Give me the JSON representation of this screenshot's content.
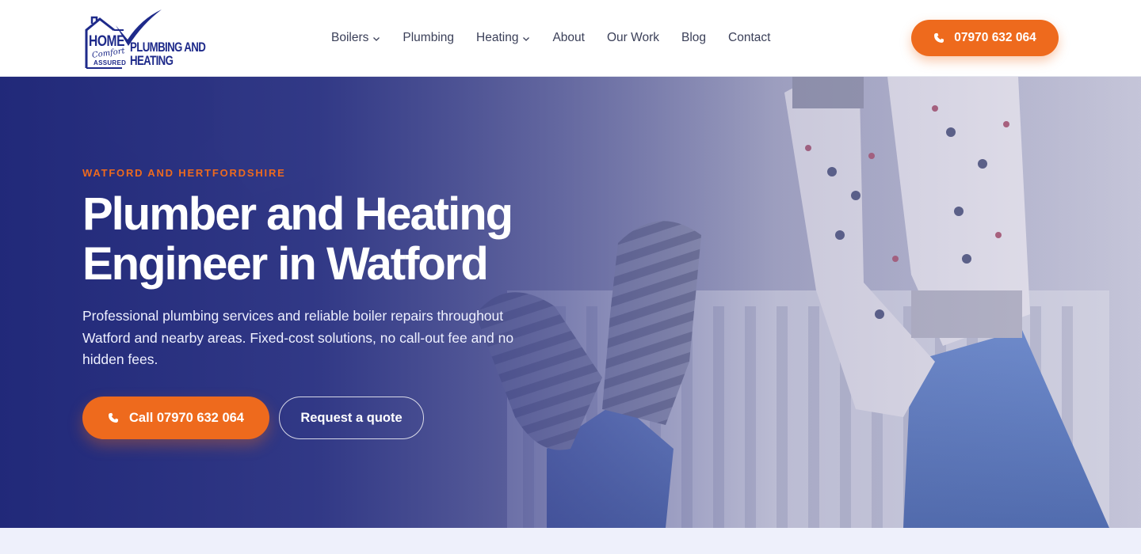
{
  "brand": {
    "logo_home": "HOME",
    "logo_comfort": "Comfort",
    "logo_assured": "ASSURED",
    "logo_line1": "PLUMBING AND",
    "logo_line2": "HEATING",
    "primary_color": "#1e2a8a",
    "accent_color": "#ee6a1d"
  },
  "nav": {
    "items": [
      {
        "label": "Boilers",
        "dropdown": true
      },
      {
        "label": "Plumbing",
        "dropdown": false
      },
      {
        "label": "Heating",
        "dropdown": true
      },
      {
        "label": "About",
        "dropdown": false
      },
      {
        "label": "Our Work",
        "dropdown": false
      },
      {
        "label": "Blog",
        "dropdown": false
      },
      {
        "label": "Contact",
        "dropdown": false
      }
    ],
    "phone_label": "07970 632 064",
    "phone_icon": "phone-icon",
    "dropdown_icon": "chevron-down-icon"
  },
  "hero": {
    "eyebrow": "WATFORD AND HERTFORDSHIRE",
    "title_line1": "Plumber and Heating",
    "title_line2": "Engineer in Watford",
    "description": "Professional plumbing services and reliable boiler repairs throughout Watford and nearby areas. Fixed-cost solutions, no call-out fee and no hidden fees.",
    "primary_cta": "Call 07970 632 064",
    "secondary_cta": "Request a quote"
  }
}
